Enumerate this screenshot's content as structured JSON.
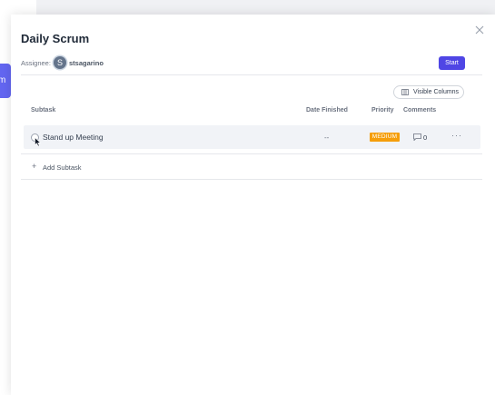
{
  "background": {
    "tab_text": "m"
  },
  "modal": {
    "title": "Daily Scrum",
    "assignee_label": "Assignee:",
    "assignee_initial": "S",
    "assignee_name": "stsagarino",
    "start_label": "Start",
    "visible_columns_label": "Visible Columns"
  },
  "table": {
    "headers": {
      "subtask": "Subtask",
      "date_finished": "Date Finished",
      "priority": "Priority",
      "comments": "Comments"
    },
    "rows": [
      {
        "title": "Stand up Meeting",
        "date_finished": "--",
        "priority": "MEDIUM",
        "comments": "0",
        "more": "···"
      }
    ],
    "add_subtask_label": "Add Subtask",
    "add_plus": "+"
  },
  "colors": {
    "accent": "#4f46e5",
    "priority_medium": "#f59e0b",
    "row_bg": "#f1f3f7"
  },
  "icons": [
    "close-icon",
    "columns-icon",
    "comment-icon",
    "more-icon",
    "plus-icon",
    "cursor-icon"
  ]
}
